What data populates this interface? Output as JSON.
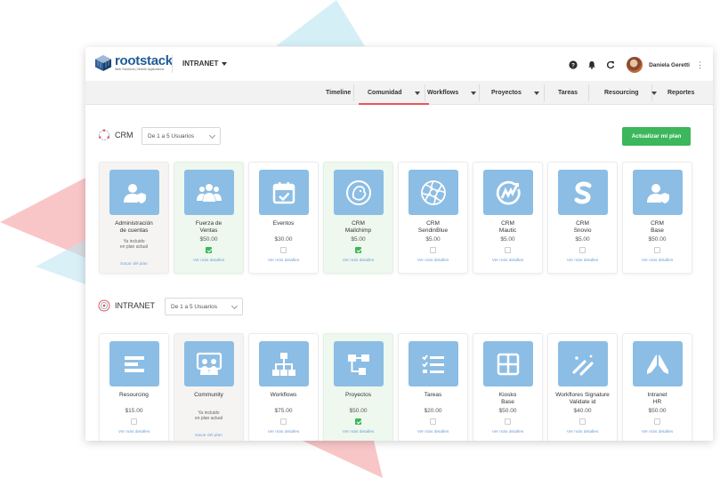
{
  "colors": {
    "accent_red": "#e8585d",
    "success_green": "#3cb75b",
    "tile_blue": "#8cbde4",
    "link_blue": "#6fa0d4"
  },
  "brand": {
    "name": "rootstack",
    "tagline": "Web Solutions | Mobile Applications"
  },
  "header": {
    "app_switcher": "INTRANET",
    "user_name": "Daniela Geretti",
    "icons": [
      "help-icon",
      "bell-icon",
      "refresh-icon",
      "kebab-menu-icon"
    ]
  },
  "nav": {
    "tabs": [
      {
        "label": "Timeline",
        "dropdown": false,
        "active": false
      },
      {
        "label": "Comunidad",
        "dropdown": true,
        "active": true
      },
      {
        "label": "Workflows",
        "dropdown": true,
        "active": false
      },
      {
        "label": "Proyectos",
        "dropdown": true,
        "active": false
      },
      {
        "label": "Tareas",
        "dropdown": false,
        "active": false
      },
      {
        "label": "Resourcing",
        "dropdown": true,
        "active": false
      },
      {
        "label": "Reportes",
        "dropdown": false,
        "active": false
      }
    ]
  },
  "upgrade_button": "Actualizar mi plan",
  "sections": [
    {
      "title": "CRM",
      "plan_select": "De 1 a 5 Usuarios",
      "cards": [
        {
          "name": "Administración\nde cuentas",
          "icon": "user-shield-icon",
          "state": "included",
          "note": "Ya incluido\nen plan actual",
          "link": "Sacar del plan"
        },
        {
          "name": "Fuerza de\nVentas",
          "icon": "users-group-icon",
          "state": "selected",
          "price": "$50.00",
          "link": "Ver más detalles"
        },
        {
          "name": "Eventos",
          "icon": "calendar-check-icon",
          "state": "none",
          "price": "$30.00",
          "link": "Ver más detalles"
        },
        {
          "name": "CRM\nMailchimp",
          "icon": "mailchimp-icon",
          "state": "selected",
          "price": "$5.00",
          "link": "Ver más detalles"
        },
        {
          "name": "CRM\nSendinBlue",
          "icon": "sendinblue-icon",
          "state": "none",
          "price": "$5.00",
          "link": "Ver más detalles"
        },
        {
          "name": "CRM\nMautic",
          "icon": "mautic-icon",
          "state": "none",
          "price": "$5.00",
          "link": "Ver más detalles"
        },
        {
          "name": "CRM\nSnovio",
          "icon": "snovio-icon",
          "state": "none",
          "price": "$5.00",
          "link": "Ver más detalles"
        },
        {
          "name": "CRM\nBase",
          "icon": "user-shield-icon",
          "state": "none",
          "price": "$50.00",
          "link": "Ver más detalles"
        }
      ]
    },
    {
      "title": "INTRANET",
      "plan_select": "De 1 a 5 Usuarios",
      "cards": [
        {
          "name": "Resourcing",
          "icon": "bars-icon",
          "state": "none",
          "price": "$15.00",
          "link": "Ver más detalles"
        },
        {
          "name": "Community",
          "icon": "community-board-icon",
          "state": "included",
          "note": "Ya incluido\nen plan actual",
          "link": "Sacar del plan"
        },
        {
          "name": "Workflows",
          "icon": "sitemap-icon",
          "state": "none",
          "price": "$75.00",
          "link": "Ver más detalles"
        },
        {
          "name": "Proyectos",
          "icon": "project-flow-icon",
          "state": "selected",
          "price": "$50.00",
          "link": "Ver más detalles"
        },
        {
          "name": "Tareas",
          "icon": "tasks-list-icon",
          "state": "none",
          "price": "$20.00",
          "link": "Ver más detalles"
        },
        {
          "name": "Kiosko\nBase",
          "icon": "kiosk-grid-icon",
          "state": "none",
          "price": "$50.00",
          "link": "Ver más detalles"
        },
        {
          "name": "Workflores Signature\nValidate id",
          "icon": "signature-icon",
          "state": "none",
          "price": "$40.00",
          "link": "Ver más detalles"
        },
        {
          "name": "Intranet\nHR",
          "icon": "hands-icon",
          "state": "none",
          "price": "$50.00",
          "link": "Ver más detalles"
        }
      ]
    }
  ]
}
